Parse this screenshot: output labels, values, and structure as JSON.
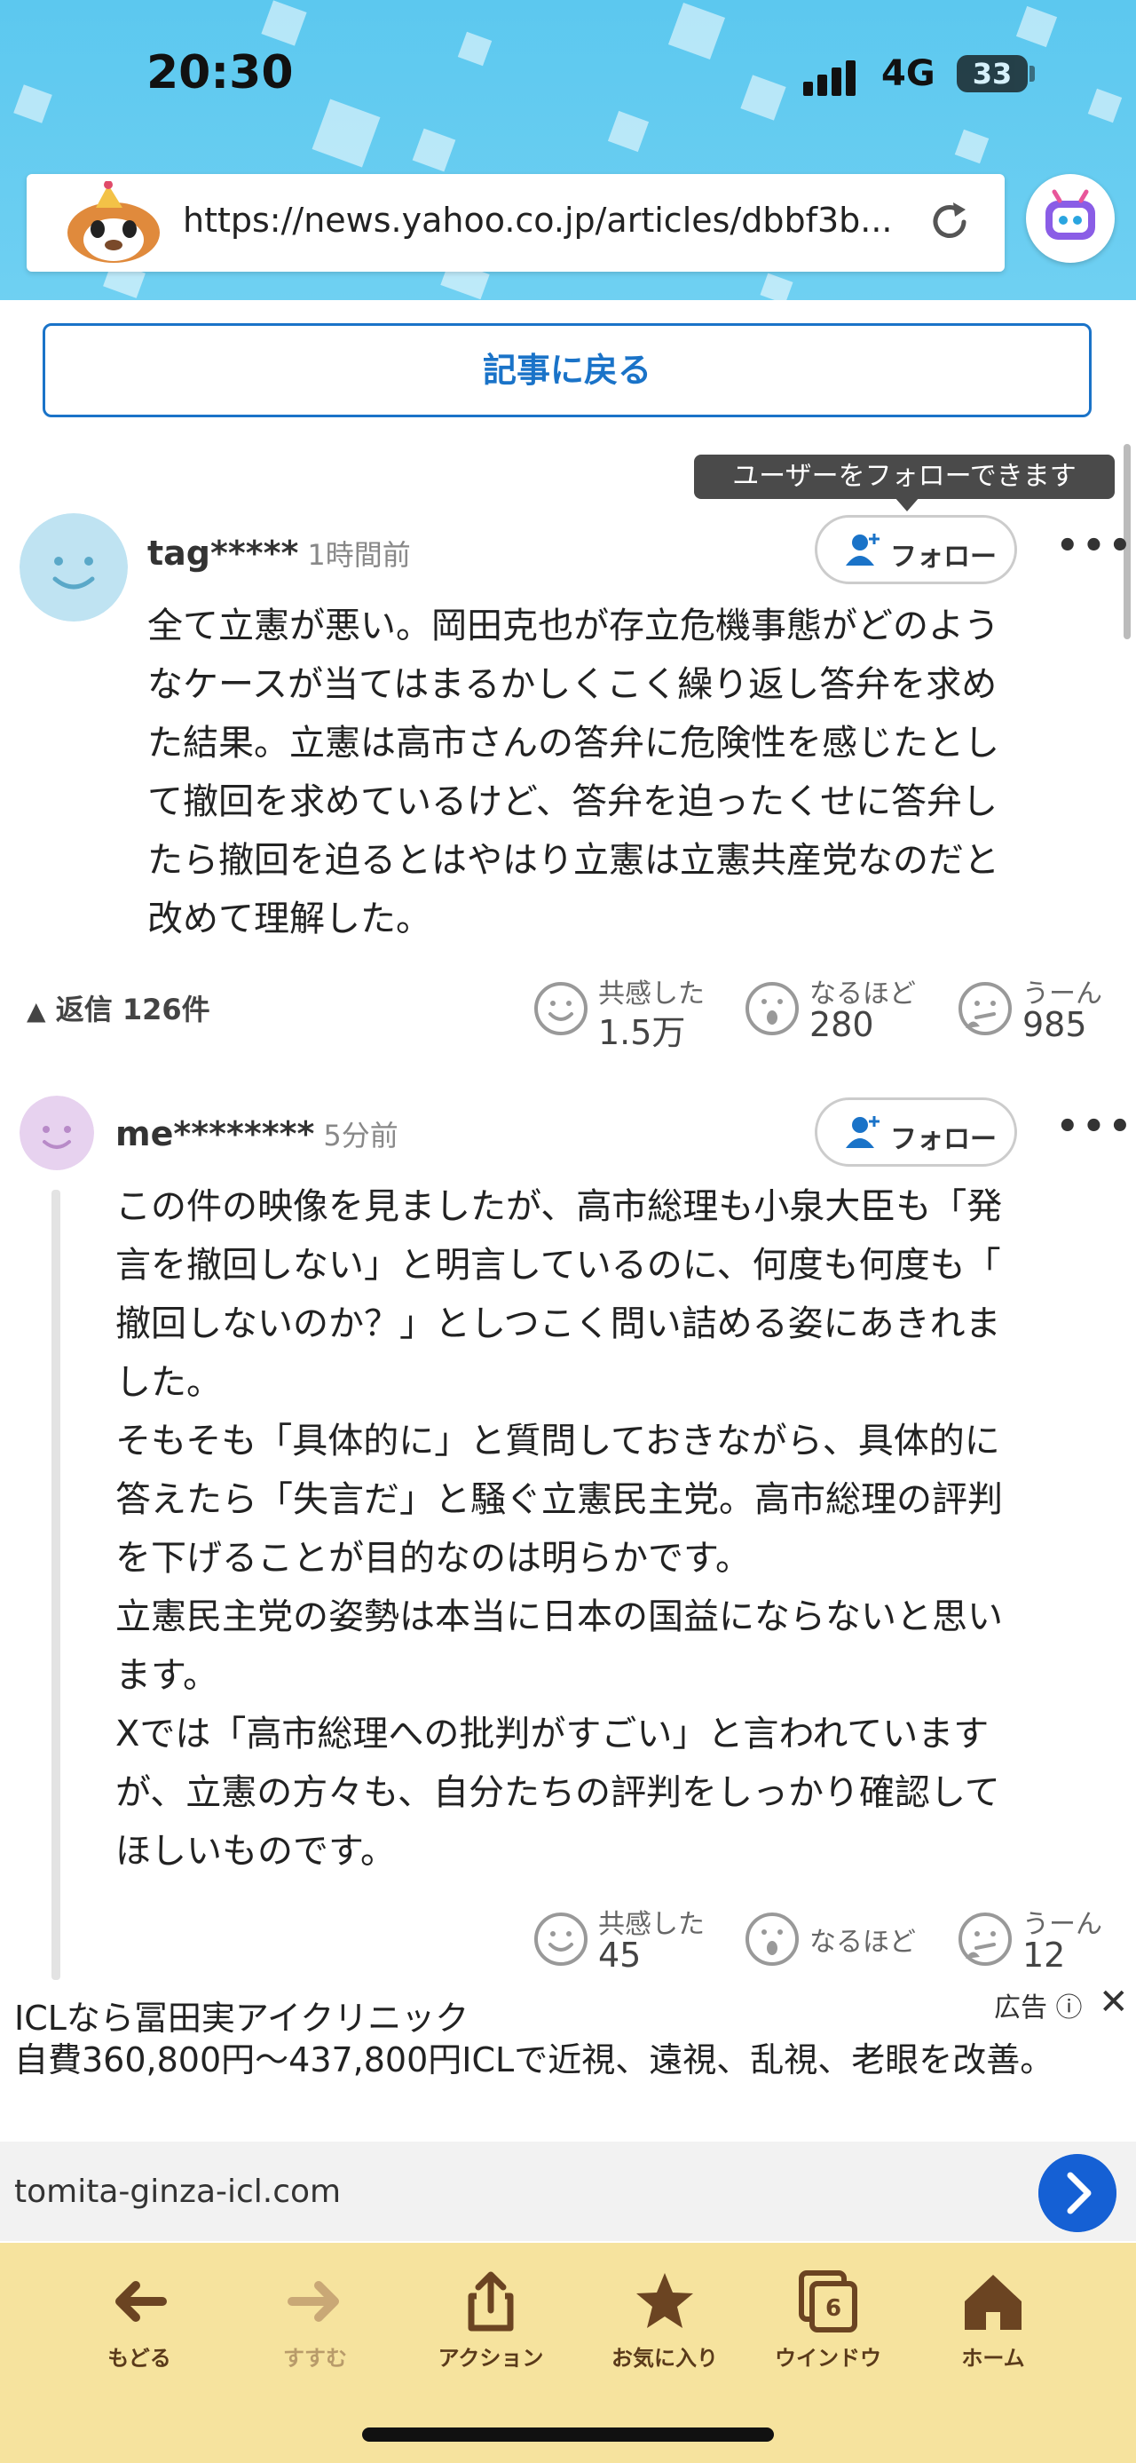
{
  "status_bar": {
    "time": "20:30",
    "network": "4G",
    "battery": "33"
  },
  "browser": {
    "url": "https://news.yahoo.co.jp/articles/dbbf3b..."
  },
  "back_to_article": "記事に戻る",
  "tooltip": "ユーザーをフォローできます",
  "comments": [
    {
      "username": "tag*****",
      "time": "1時間前",
      "follow_label": "フォロー",
      "lines": [
        "全て立憲が悪い。岡田克也が存立危機事態がどのよう",
        "なケースが当てはまるかしくこく繰り返し答弁を求め",
        "た結果。立憲は高市さんの答弁に危険性を感じたとし",
        "て撤回を求めているけど、答弁を迫ったくせに答弁し",
        "たら撤回を迫るとはやはり立憲は立憲共産党なのだと",
        "改めて理解した。"
      ],
      "replies": "返信 126件",
      "reactions": [
        {
          "label": "共感した",
          "value": "1.5万"
        },
        {
          "label": "なるほど",
          "value": "280"
        },
        {
          "label": "うーん",
          "value": "985"
        }
      ]
    },
    {
      "username": "me********",
      "time": "5分前",
      "follow_label": "フォロー",
      "lines": [
        "この件の映像を見ましたが、高市総理も小泉大臣も「発",
        "言を撤回しない」と明言しているのに、何度も何度も「",
        "撤回しないのか？」としつこく問い詰める姿にあきれま",
        "した。",
        "そもそも「具体的に」と質問しておきながら、具体的に",
        "答えたら「失言だ」と騒ぐ立憲民主党。高市総理の評判",
        "を下げることが目的なのは明らかです。",
        "立憲民主党の姿勢は本当に日本の国益にならないと思い",
        "ます。",
        "Xでは「高市総理への批判がすごい」と言われています",
        "が、立憲の方々も、自分たちの評判をしっかり確認して",
        "ほしいものです。"
      ],
      "reactions": [
        {
          "label": "共感した",
          "value": "45"
        },
        {
          "label": "なるほど",
          "value": ""
        },
        {
          "label": "うーん",
          "value": "12"
        }
      ]
    }
  ],
  "ad": {
    "title": "ICLなら冨田実アイクリニック",
    "text": "自費360,800円〜437,800円ICLで近視、遠視、乱視、老眼を改善。",
    "label": "広告",
    "domain": "tomita-ginza-icl.com"
  },
  "toolbar": {
    "back": "もどる",
    "forward": "すすむ",
    "action": "アクション",
    "bookmarks": "お気に入り",
    "windows": "ウインドウ",
    "window_count": "6",
    "home": "ホーム"
  }
}
